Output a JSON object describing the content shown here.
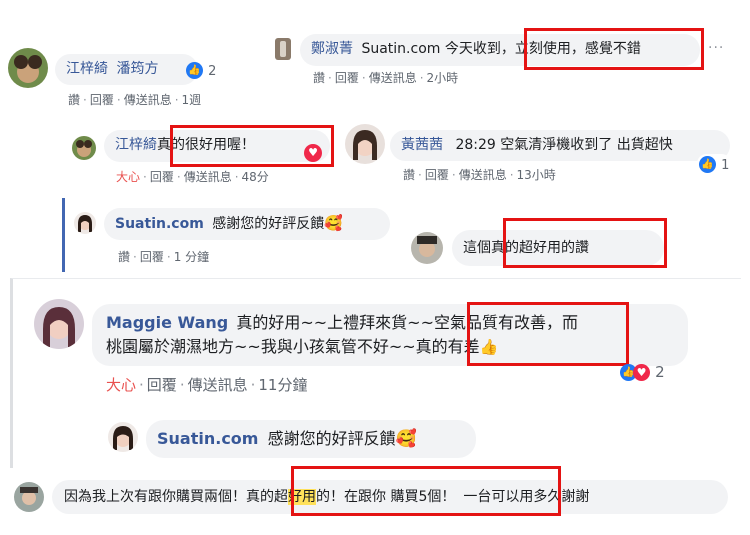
{
  "c1": {
    "author": "江梓綺",
    "text": "潘筠方",
    "reaction_count": "2",
    "actions": [
      "讚",
      "回覆",
      "傳送訊息",
      "1週"
    ]
  },
  "c2": {
    "author": "鄭淑菁",
    "text_pre": "Suatin.com 今天收到，",
    "text_box": "立刻使用，感覺不錯",
    "actions": [
      "讚",
      "回覆",
      "傳送訊息",
      "2小時"
    ]
  },
  "c3": {
    "author": "江梓綺",
    "text_box": "真的很好用喔！",
    "actions": [
      "大心",
      "回覆",
      "傳送訊息",
      "48分"
    ]
  },
  "c4": {
    "author": "黃茜茜",
    "text": "28:29  空氣清淨機收到了 出貨超快",
    "reaction_count": "1",
    "actions": [
      "讚",
      "回覆",
      "傳送訊息",
      "13小時"
    ]
  },
  "c5": {
    "author": "Suatin.com",
    "text": "感謝您的好評反饋",
    "actions": [
      "讚",
      "回覆",
      "1 分鐘"
    ]
  },
  "c6": {
    "text_pre": "這個",
    "text_box": "真的超好用的讚"
  },
  "c7": {
    "author": "Maggie Wang",
    "line1_pre": "真的好用~~上禮拜來貨~~",
    "line1_box": "空氣品質有改善",
    "line1_post": "，而",
    "line2_pre": "桃園屬於潮濕地方~~我與小孩氣管不好~~",
    "line2_box": "真的有差",
    "reaction_count": "2",
    "actions": [
      "大心",
      "回覆",
      "傳送訊息",
      "11分鐘"
    ]
  },
  "c8": {
    "author": "Suatin.com",
    "text": "感謝您的好評反饋"
  },
  "c9": {
    "text_pre": "因為我上次有跟你購買兩個！",
    "box_a": "真的超",
    "box_hl": "好用",
    "box_b": "的！在跟你 購買5個！",
    "text_post": "一台可以用多久謝謝"
  }
}
